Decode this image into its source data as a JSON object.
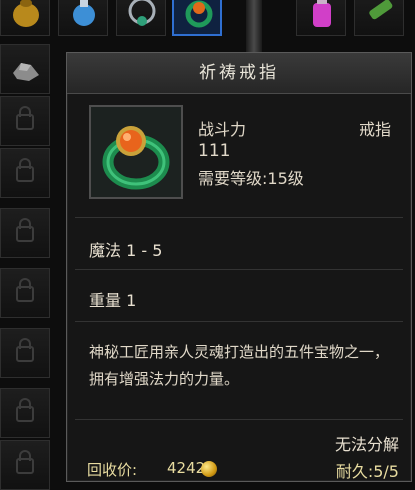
{
  "tooltip": {
    "title": "祈祷戒指",
    "stat_label": "战斗力",
    "item_type": "戒指",
    "power": "111",
    "required_level": "需要等级:15级",
    "magic": "魔法 1 - 5",
    "weight": "重量 1",
    "description": "神秘工匠用亲人灵魂打造出的五件宝物之一，拥有增强法力的力量。",
    "no_dismantle": "无法分解",
    "recycle_label": "回收价:",
    "recycle_value": "4242",
    "durability": "耐久:5/5"
  },
  "colors": {
    "gold_text": "#e8dca0",
    "selected_border": "#2f6fd1",
    "panel_bg": "#161616"
  },
  "icons": [
    "gold-pouch-icon",
    "blue-potion-icon",
    "necklace-icon",
    "ring-icon",
    "pink-potion-icon",
    "scroll-icon",
    "ore-icon",
    "lock-icon",
    "coin-icon"
  ]
}
